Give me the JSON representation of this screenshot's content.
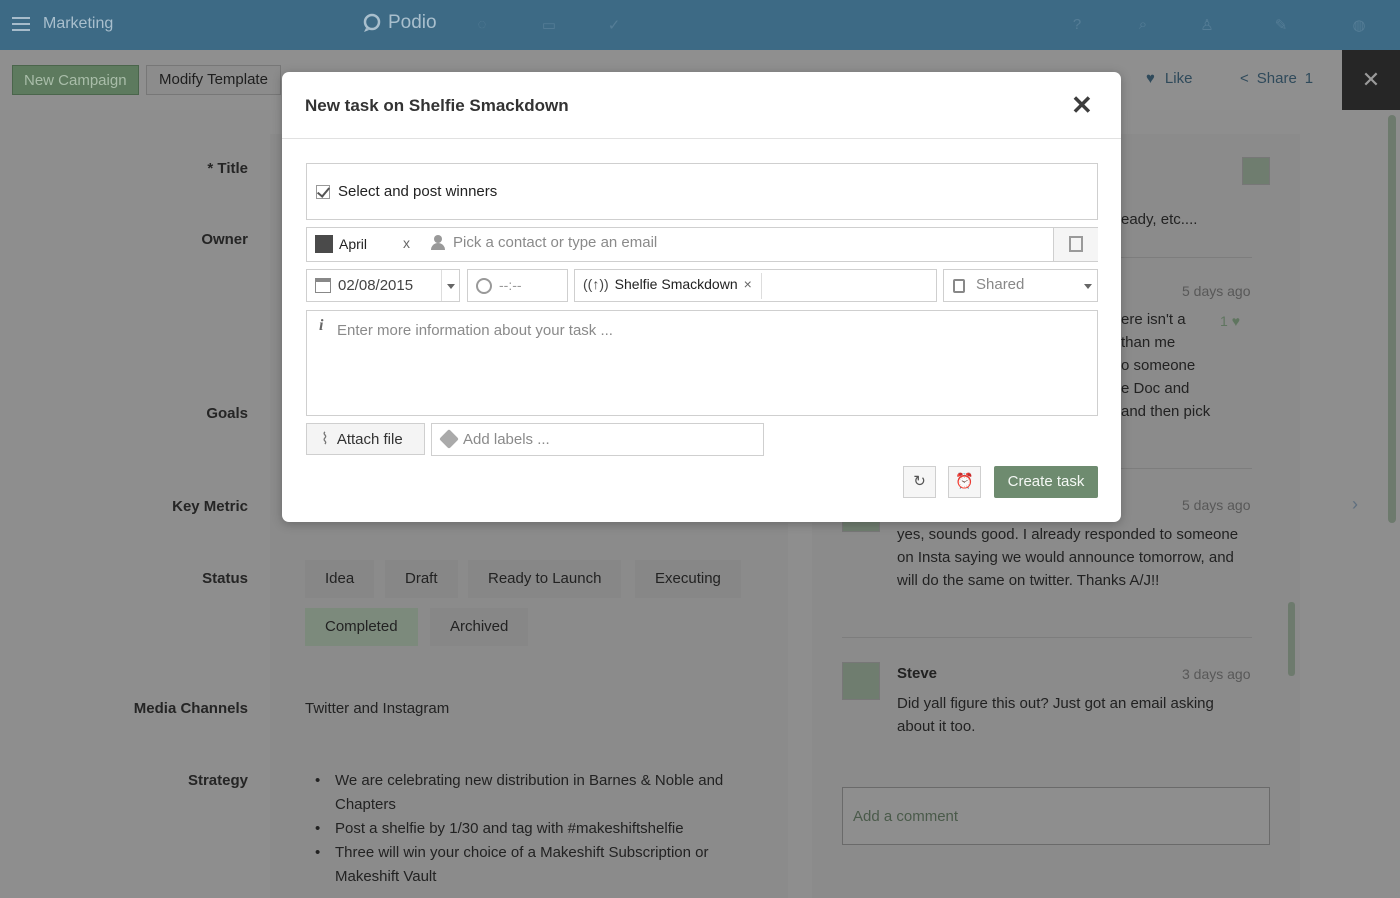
{
  "topbar": {
    "workspace": "Marketing",
    "brand": "Podio"
  },
  "toolbar": {
    "new_campaign": "New Campaign",
    "modify_template": "Modify Template",
    "like": "Like",
    "share": "Share",
    "share_count": "1"
  },
  "fields": {
    "title_label": "* Title",
    "owner_label": "Owner",
    "goals_label": "Goals",
    "key_metric_label": "Key Metric",
    "status_label": "Status",
    "media_label": "Media Channels",
    "strategy_label": "Strategy",
    "status_options": [
      "Idea",
      "Draft",
      "Ready to Launch",
      "Executing",
      "Completed",
      "Archived"
    ],
    "media_value": "Twitter and Instagram",
    "strategy_items": [
      "We are celebrating new distribution in Barnes & Noble and Chapters",
      "Post a shelfie by 1/30 and tag with #makeshiftshelfie",
      "Three will win your choice of a Makeshift Subscription or Makeshift Vault"
    ]
  },
  "comments": {
    "partial_top": "eady, etc....",
    "c1": {
      "time": "5 days ago",
      "likes": "1",
      "lines": [
        "ere isn't a",
        "than me",
        "o someone",
        "e Doc and",
        "and then pick"
      ]
    },
    "c2": {
      "time": "5 days ago",
      "text": "yes, sounds good. I already responded to someone on Insta saying we would announce tomorrow, and will do the same on twitter. Thanks A/J!!"
    },
    "c3": {
      "name": "Steve",
      "time": "3 days ago",
      "text": "Did yall figure this out? Just got an email asking about it too."
    },
    "add_placeholder": "Add a comment"
  },
  "modal": {
    "title": "New task on Shelfie Smackdown",
    "task_title": "Select and post winners",
    "owner": "April",
    "contact_placeholder": "Pick a contact or type an email",
    "date": "02/08/2015",
    "time": "--:--",
    "reference": "Shelfie Smackdown",
    "privacy": "Shared",
    "description_placeholder": "Enter more information about your task ...",
    "attach_label": "Attach file",
    "labels_placeholder": "Add labels ...",
    "create_label": "Create task"
  }
}
